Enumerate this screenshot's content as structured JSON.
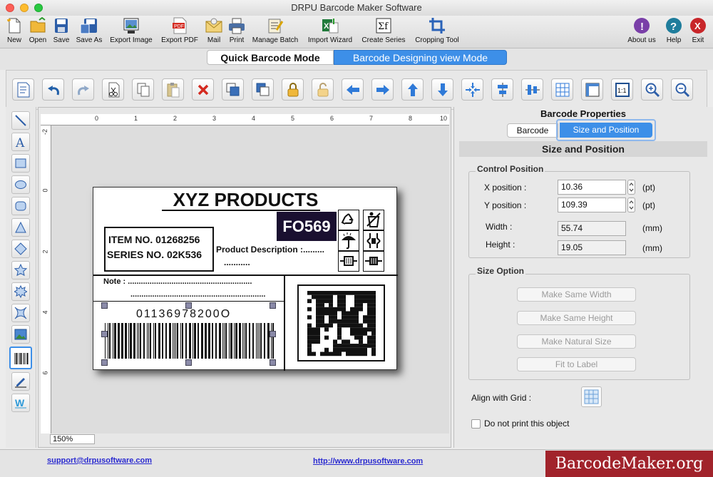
{
  "app": {
    "title": "DRPU Barcode Maker Software"
  },
  "toolbar": [
    {
      "label": "New",
      "icon": "new-document-icon"
    },
    {
      "label": "Open",
      "icon": "open-folder-icon"
    },
    {
      "label": "Save",
      "icon": "save-icon"
    },
    {
      "label": "Save As",
      "icon": "save-as-icon"
    },
    {
      "label": "Export Image",
      "icon": "export-image-icon"
    },
    {
      "label": "Export PDF",
      "icon": "export-pdf-icon"
    },
    {
      "label": "Mail",
      "icon": "mail-icon"
    },
    {
      "label": "Print",
      "icon": "print-icon"
    },
    {
      "label": "Manage Batch",
      "icon": "manage-batch-icon"
    },
    {
      "label": "Import Wizard",
      "icon": "import-wizard-icon"
    },
    {
      "label": "Create Series",
      "icon": "create-series-icon"
    },
    {
      "label": "Cropping Tool",
      "icon": "crop-icon"
    },
    {
      "label": "About us",
      "icon": "about-icon"
    },
    {
      "label": "Help",
      "icon": "help-icon"
    },
    {
      "label": "Exit",
      "icon": "exit-icon"
    }
  ],
  "modes": {
    "quick": "Quick Barcode Mode",
    "designing": "Barcode Designing view Mode"
  },
  "label": {
    "title": "XYZ PRODUCTS",
    "code": "FO569",
    "item_no": "ITEM NO. 01268256",
    "series_no": "SERIES NO. 02K536",
    "product_description": "Product Description :.........",
    "product_description_dots": "...........",
    "note": "Note : .........................................................",
    "note_dots": "..............................................................",
    "barcode_number": "01136978200O"
  },
  "ruler": {
    "h": [
      "0",
      "1",
      "2",
      "3",
      "4",
      "5",
      "6",
      "7",
      "8",
      "10"
    ],
    "v": [
      "-2",
      "0",
      "2",
      "4",
      "6"
    ]
  },
  "zoom": "150%",
  "panel": {
    "title": "Barcode Properties",
    "tab_barcode": "Barcode",
    "tab_size": "Size and Position",
    "section": "Size and Position",
    "control_position": "Control Position",
    "x_label": "X position :",
    "x_value": "10.36",
    "x_unit": "(pt)",
    "y_label": "Y position :",
    "y_value": "109.39",
    "y_unit": "(pt)",
    "width_label": "Width :",
    "width_value": "55.74",
    "width_unit": "(mm)",
    "height_label": "Height :",
    "height_value": "19.05",
    "height_unit": "(mm)",
    "size_option": "Size Option",
    "btn_same_width": "Make Same Width",
    "btn_same_height": "Make Same Height",
    "btn_natural": "Make Natural Size",
    "btn_fit": "Fit to Label",
    "align_grid": "Align with Grid :",
    "no_print": "Do not print this object"
  },
  "status": {
    "email": "support@drpusoftware.com",
    "url": "http://www.drpusoftware.com"
  },
  "watermark": "BarcodeMaker.org",
  "colors": {
    "accent": "#3d8fe8",
    "watermark_bg": "#a1232b",
    "label_code_bg": "#1a1030"
  }
}
